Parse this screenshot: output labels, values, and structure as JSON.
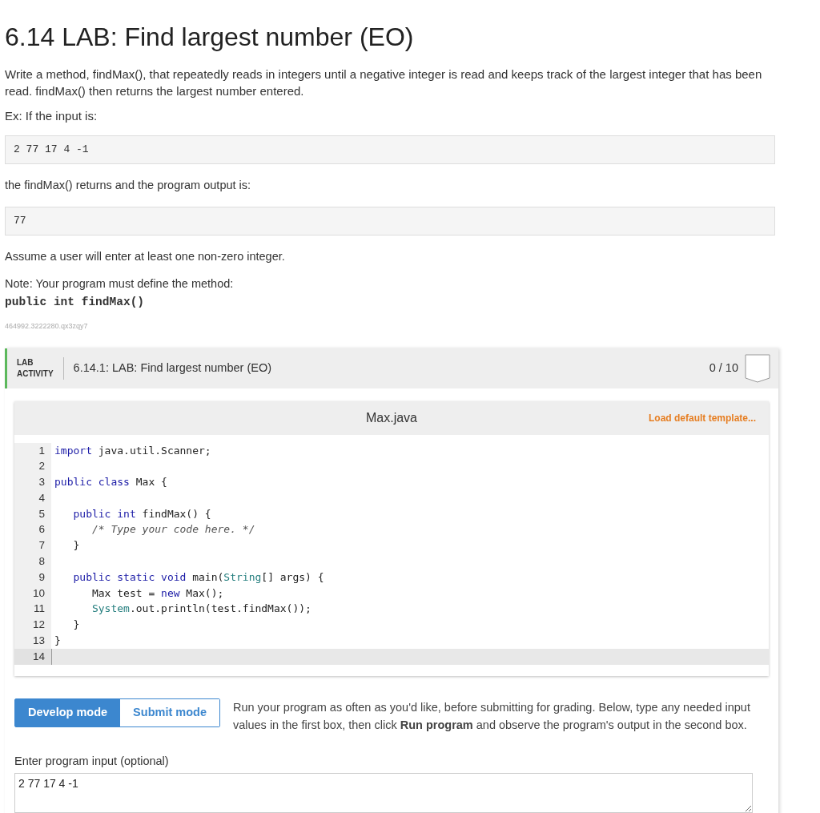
{
  "title": "6.14 LAB: Find largest number (EO)",
  "paragraphs": [
    "Write a method, findMax(), that repeatedly reads in integers until a negative integer is read and keeps track of the largest integer that has been read. findMax() then returns the largest number entered.",
    "Ex: If the input is:"
  ],
  "example_input": "2 77 17 4 -1",
  "output_intro": "the findMax() returns and the program output is:",
  "example_output": "77",
  "assume": "Assume a user will enter at least one non-zero integer.",
  "note": "Note: Your program must define the method:",
  "signature": "public int findMax()",
  "id_code": "464992.3222280.qx3zqy7",
  "lab": {
    "tag_lines": [
      "LAB",
      "ACTIVITY"
    ],
    "title": "6.14.1: LAB: Find largest number (EO)",
    "score": "0 / 10"
  },
  "editor": {
    "filename": "Max.java",
    "load_template": "Load default template...",
    "lines": [
      {
        "number": "1",
        "active": false,
        "tokens": [
          {
            "text": "import",
            "kind": "keyword"
          },
          {
            "text": " java.util.Scanner;",
            "kind": "plain"
          }
        ]
      },
      {
        "number": "2",
        "active": false
      },
      {
        "number": "3",
        "active": false,
        "tokens": [
          {
            "text": "public class",
            "kind": "keyword"
          },
          {
            "text": " Max {",
            "kind": "plain"
          }
        ]
      },
      {
        "number": "4",
        "active": false
      },
      {
        "number": "5",
        "active": false,
        "tokens": [
          {
            "text": "   public int",
            "kind": "keyword"
          },
          {
            "text": " findMax() {",
            "kind": "plain"
          }
        ]
      },
      {
        "number": "6",
        "active": false,
        "tokens": [
          {
            "text": "      /* Type your code here. */",
            "kind": "comment"
          }
        ]
      },
      {
        "number": "7",
        "active": false,
        "tokens": [
          {
            "text": "   }",
            "kind": "plain"
          }
        ]
      },
      {
        "number": "8",
        "active": false
      },
      {
        "number": "9",
        "active": false,
        "tokens": [
          {
            "text": "   public static void",
            "kind": "keyword"
          },
          {
            "text": " main(",
            "kind": "plain"
          },
          {
            "text": "String",
            "kind": "type"
          },
          {
            "text": "[] args) {",
            "kind": "plain"
          }
        ]
      },
      {
        "number": "10",
        "active": false,
        "tokens": [
          {
            "text": "      Max test = ",
            "kind": "plain"
          },
          {
            "text": "new",
            "kind": "keyword"
          },
          {
            "text": " Max();",
            "kind": "plain"
          }
        ]
      },
      {
        "number": "11",
        "active": false,
        "tokens": [
          {
            "text": "      System",
            "kind": "type"
          },
          {
            "text": ".out.println(test.findMax());",
            "kind": "plain"
          }
        ]
      },
      {
        "number": "12",
        "active": false,
        "tokens": [
          {
            "text": "   }",
            "kind": "plain"
          }
        ]
      },
      {
        "number": "13",
        "active": false,
        "tokens": [
          {
            "text": "}",
            "kind": "plain"
          }
        ]
      },
      {
        "number": "14",
        "active": true
      }
    ]
  },
  "modes": [
    {
      "label": "Develop mode",
      "selected": true
    },
    {
      "label": "Submit mode",
      "selected": false
    }
  ],
  "instructions": "Run your program as often as you'd like, before submitting for grading. Below, type any needed input values in the first box, then click **Run program** and observe the program's output in the second box.",
  "input_label": "Enter program input (optional)",
  "input_value": "2 77 17 4 -1"
}
